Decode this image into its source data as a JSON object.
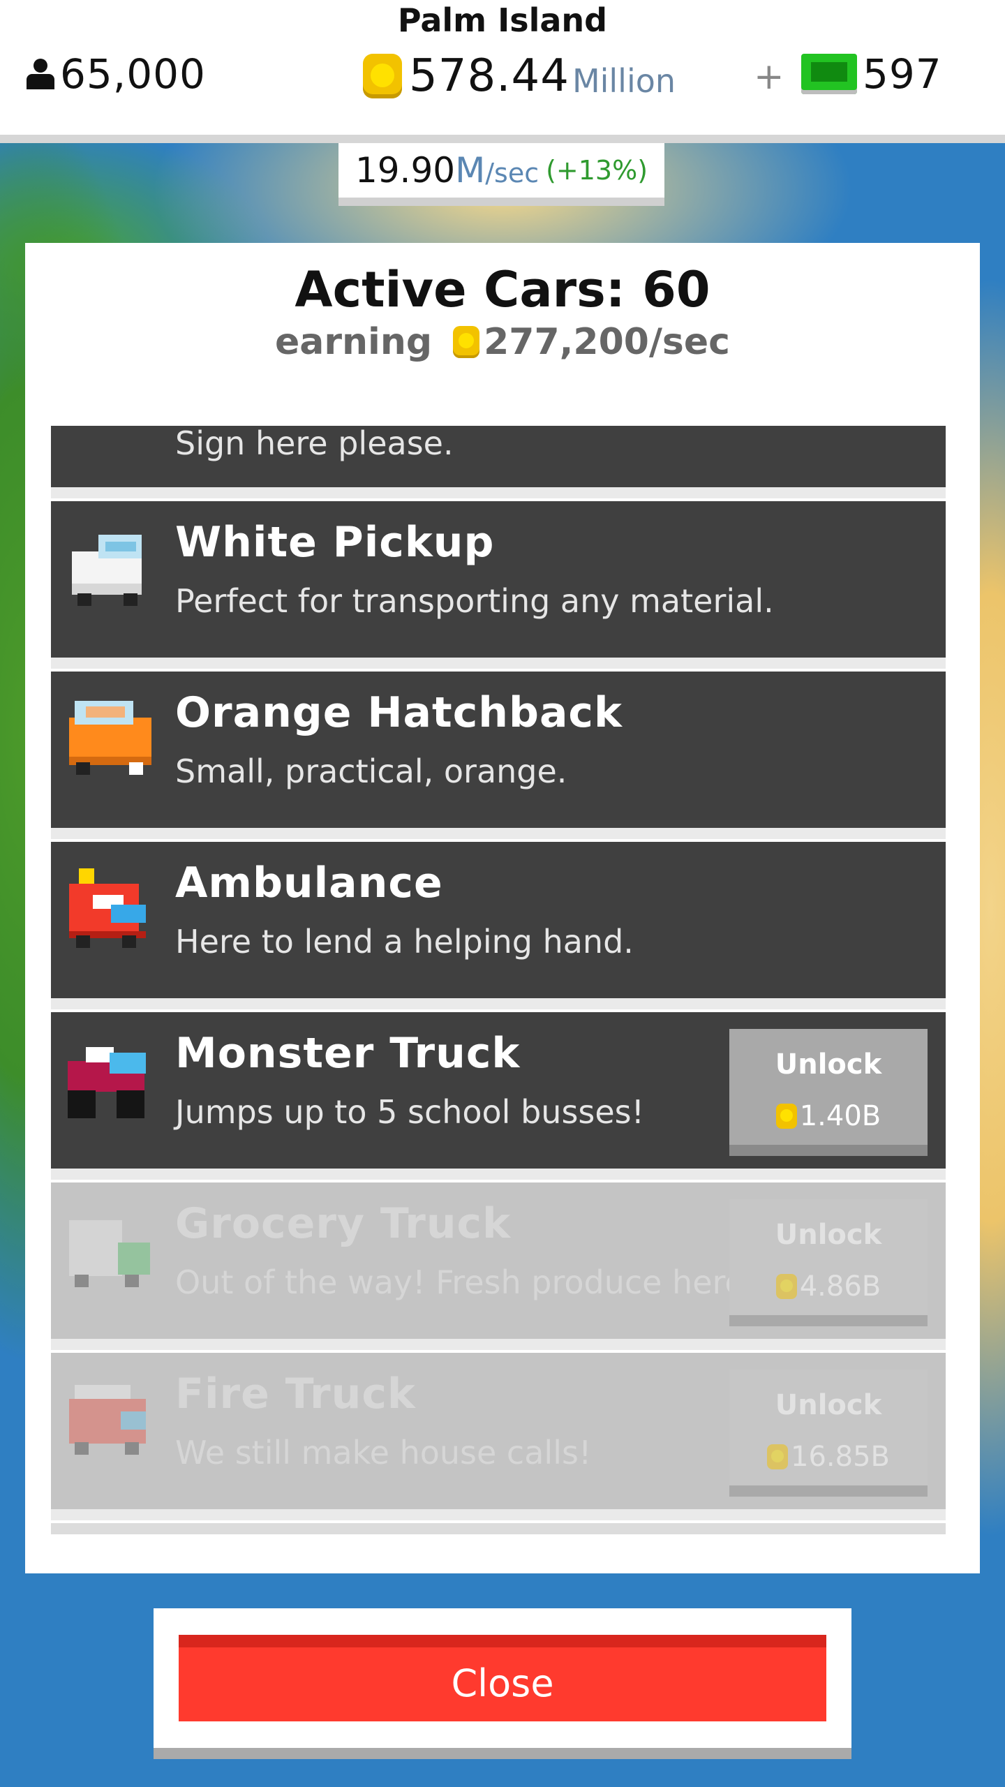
{
  "hud": {
    "island_name": "Palm Island",
    "population": "65,000",
    "coins_amount": "578.44",
    "coins_unit": "Million",
    "plus": "+",
    "cash": "597"
  },
  "rate": {
    "value": "19.90",
    "unit_m": "M",
    "unit_sec": "/sec",
    "bonus": "(+13%)"
  },
  "panel": {
    "title": "Active Cars: 60",
    "earning_label": "earning",
    "earning_value": "277,200/sec"
  },
  "cars": [
    {
      "name": "",
      "desc": "Sign here please.",
      "locked": false
    },
    {
      "name": "White Pickup",
      "desc": "Perfect for transporting any material.",
      "locked": false
    },
    {
      "name": "Orange Hatchback",
      "desc": "Small, practical, orange.",
      "locked": false
    },
    {
      "name": "Ambulance",
      "desc": "Here to lend a helping hand.",
      "locked": false
    },
    {
      "name": "Monster Truck",
      "desc": "Jumps up to 5 school busses!",
      "locked": false,
      "unlock_label": "Unlock",
      "price": "1.40B"
    },
    {
      "name": "Grocery Truck",
      "desc": "Out of the way! Fresh produce here!",
      "locked": true,
      "unlock_label": "Unlock",
      "price": "4.86B"
    },
    {
      "name": "Fire Truck",
      "desc": "We still make house calls!",
      "locked": true,
      "unlock_label": "Unlock",
      "price": "16.85B"
    }
  ],
  "icons": {
    "pickup": "white-pickup-icon",
    "hatchback": "orange-hatchback-icon",
    "ambulance": "ambulance-icon",
    "monster": "monster-truck-icon",
    "grocery": "grocery-truck-icon",
    "fire": "fire-truck-icon"
  },
  "colors": {
    "close_button": "#ff3a2e",
    "row_unlocked": "#404040",
    "row_locked": "#c4c4c4",
    "bonus_green": "#2f9a2f",
    "coin_yellow": "#f2c200"
  },
  "close_label": "Close"
}
